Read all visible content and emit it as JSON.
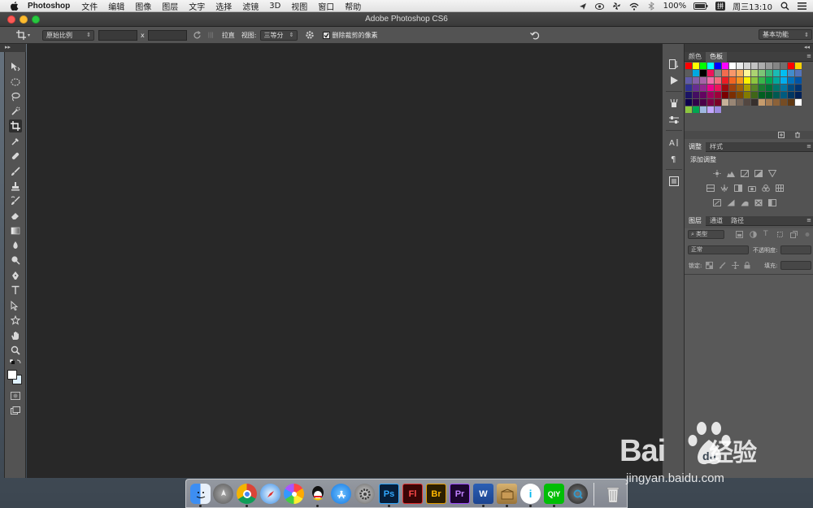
{
  "menubar": {
    "app_name": "Photoshop",
    "items": [
      "文件",
      "编辑",
      "图像",
      "图层",
      "文字",
      "选择",
      "滤镜",
      "3D",
      "视图",
      "窗口",
      "帮助"
    ],
    "battery": "100%",
    "input_method": "拼",
    "clock": "周三13:10"
  },
  "window": {
    "title": "Adobe Photoshop CS6"
  },
  "options": {
    "ratio_label": "原始比例",
    "x_sep": "x",
    "straighten_label": "拉直",
    "view_label": "视图:",
    "view_value": "三等分",
    "delete_cropped_label": "删除裁剪的像素",
    "workspace": "基本功能"
  },
  "swatch_panel": {
    "tabs": [
      "颜色",
      "色板"
    ],
    "active_tab": "色板"
  },
  "adjust_panel": {
    "tabs": [
      "调整",
      "样式"
    ],
    "active_tab": "调整",
    "heading": "添加调整"
  },
  "layers_panel": {
    "tabs": [
      "图层",
      "通道",
      "路径"
    ],
    "active_tab": "图层",
    "filter_kind": "类型",
    "blend_mode": "正常",
    "opacity_label": "不透明度:",
    "lock_label": "锁定:",
    "fill_label": "填充:"
  },
  "colors": {
    "canvas": "#282828",
    "panel": "#535353",
    "accent_swatches": [
      "#ff0000",
      "#ffff00",
      "#00ff00",
      "#00ffff",
      "#0000ff",
      "#ff00ff"
    ]
  },
  "dock_apps": [
    "Finder",
    "Launchpad",
    "Chrome",
    "Safari",
    "Photos",
    "QQ",
    "App Store",
    "System Preferences",
    "Ps",
    "Fl",
    "Br",
    "Pr",
    "Word",
    "Archive Utility",
    "iQiyi",
    "QIY",
    "QuickTime",
    "Trash"
  ],
  "watermark": {
    "brand": "Bai",
    "brand_cn": "经验",
    "url": "jingyan.baidu.com"
  }
}
